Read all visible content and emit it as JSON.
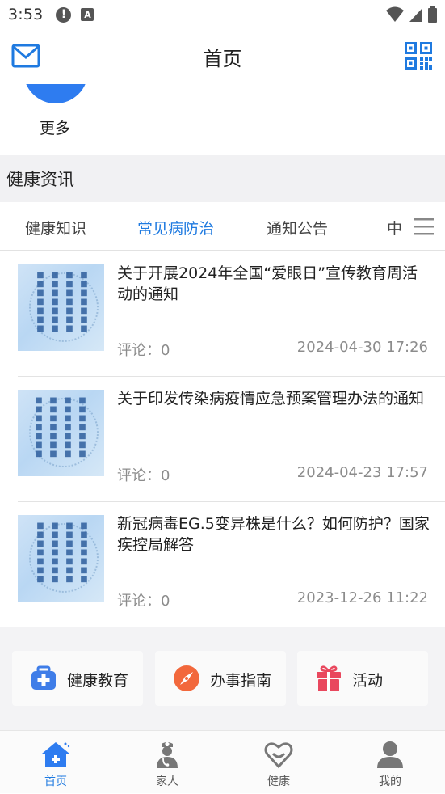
{
  "status_bar": {
    "time": "3:53",
    "a_label": "A"
  },
  "header": {
    "title": "首页"
  },
  "shortcut": {
    "more_label": "更多"
  },
  "news_section": {
    "title": "健康资讯",
    "tabs": [
      {
        "label": "健康知识",
        "active": false
      },
      {
        "label": "常见病防治",
        "active": true
      },
      {
        "label": "通知公告",
        "active": false
      },
      {
        "label": "中",
        "active": false
      }
    ],
    "items": [
      {
        "title": "关于开展2024年全国“爱眼日”宣传教育周活动的通知",
        "comments": "评论：0",
        "time": "2024-04-30 17:26"
      },
      {
        "title": "关于印发传染病疫情应急预案管理办法的通知",
        "comments": "评论：0",
        "time": "2024-04-23 17:57"
      },
      {
        "title": "新冠病毒EG.5变异株是什么？如何防护？国家疾控局解答",
        "comments": "评论：0",
        "time": "2023-12-26 11:22"
      }
    ]
  },
  "quick_actions": [
    {
      "label": "健康教育",
      "icon": "medical-kit-icon",
      "color": "#3f7de8"
    },
    {
      "label": "办事指南",
      "icon": "compass-icon",
      "color": "#f2683c"
    },
    {
      "label": "活动",
      "icon": "gift-icon",
      "color": "#e9485e"
    }
  ],
  "bottom_nav": [
    {
      "label": "首页",
      "icon": "home-icon",
      "active": true
    },
    {
      "label": "家人",
      "icon": "family-doctor-icon",
      "active": false
    },
    {
      "label": "健康",
      "icon": "heart-icon",
      "active": false
    },
    {
      "label": "我的",
      "icon": "profile-icon",
      "active": false
    }
  ],
  "colors": {
    "accent": "#1f7ae0",
    "section_bg": "#f1f1f3"
  }
}
